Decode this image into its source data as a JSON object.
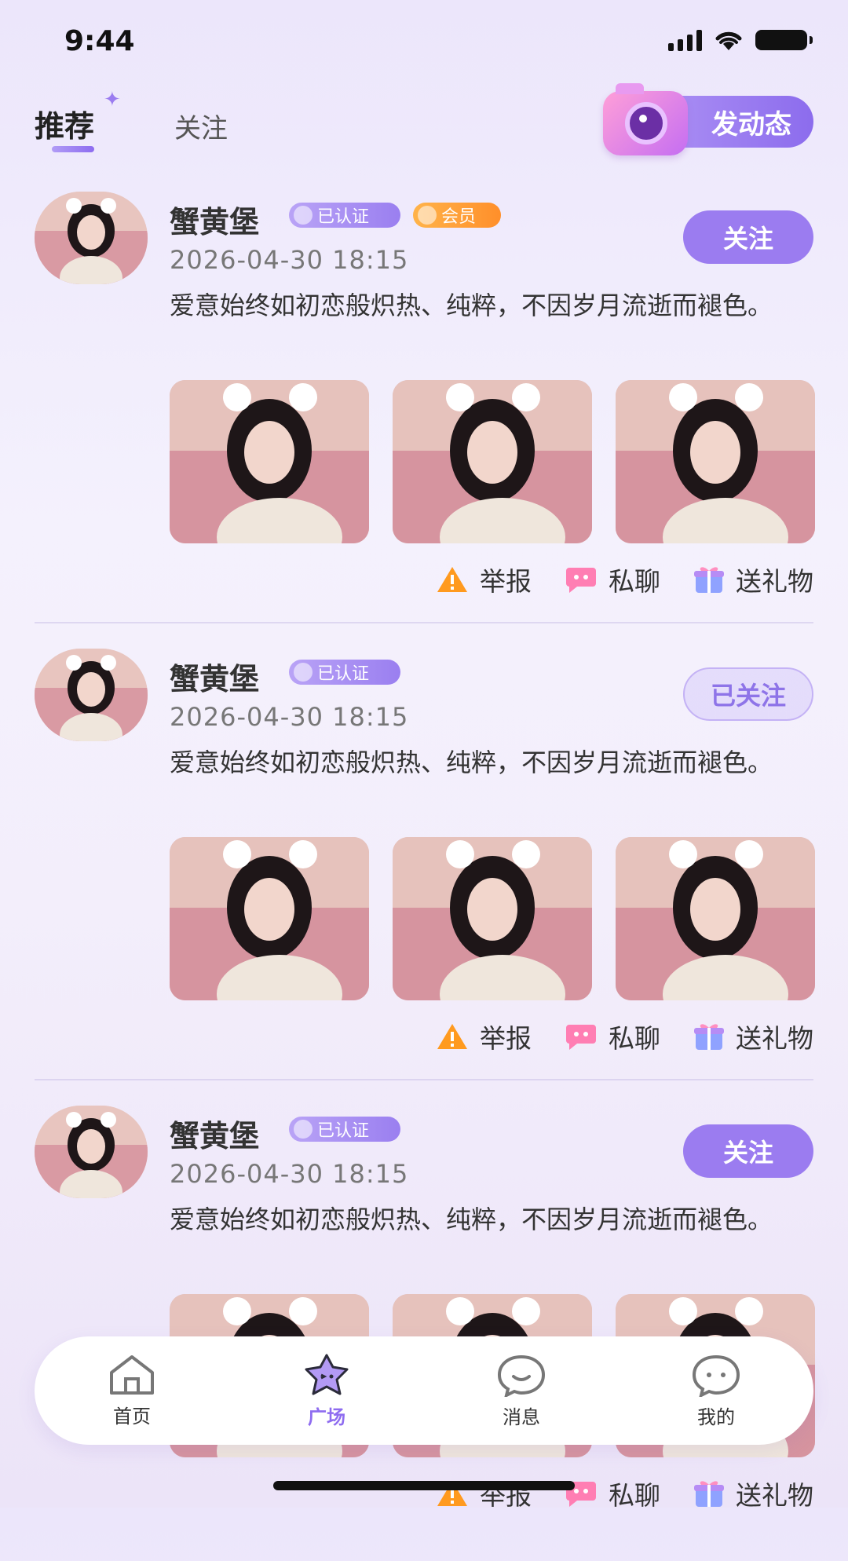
{
  "status_bar": {
    "time": "9:44"
  },
  "top_tabs": {
    "recommend": "推荐",
    "follow": "关注",
    "post_button": "发动态"
  },
  "posts": [
    {
      "name": "蟹黄堡",
      "verified": "已认证",
      "vip": "会员",
      "date": "2026-04-30 18:15",
      "follow": "关注",
      "text": "爱意始终如初恋般炽热、纯粹，不因岁月流逝而褪色。",
      "actions": {
        "report": "举报",
        "chat": "私聊",
        "gift": "送礼物"
      }
    },
    {
      "name": "蟹黄堡",
      "verified": "已认证",
      "date": "2026-04-30 18:15",
      "follow": "已关注",
      "text": "爱意始终如初恋般炽热、纯粹，不因岁月流逝而褪色。",
      "actions": {
        "report": "举报",
        "chat": "私聊",
        "gift": "送礼物"
      }
    },
    {
      "name": "蟹黄堡",
      "verified": "已认证",
      "date": "2026-04-30 18:15",
      "follow": "关注",
      "text": "爱意始终如初恋般炽热、纯粹，不因岁月流逝而褪色。",
      "actions": {
        "report": "举报",
        "chat": "私聊",
        "gift": "送礼物"
      }
    }
  ],
  "tabbar": {
    "home": "首页",
    "square": "广场",
    "messages": "消息",
    "mine": "我的"
  },
  "colors": {
    "accent": "#9b7cf0",
    "vip": "#ff9a34"
  },
  "icons": [
    "signal-icon",
    "wifi-icon",
    "battery-icon",
    "sparkle-icon",
    "camera-icon",
    "warning-icon",
    "chat-icon",
    "gift-icon",
    "home-icon",
    "star-icon",
    "message-icon"
  ]
}
